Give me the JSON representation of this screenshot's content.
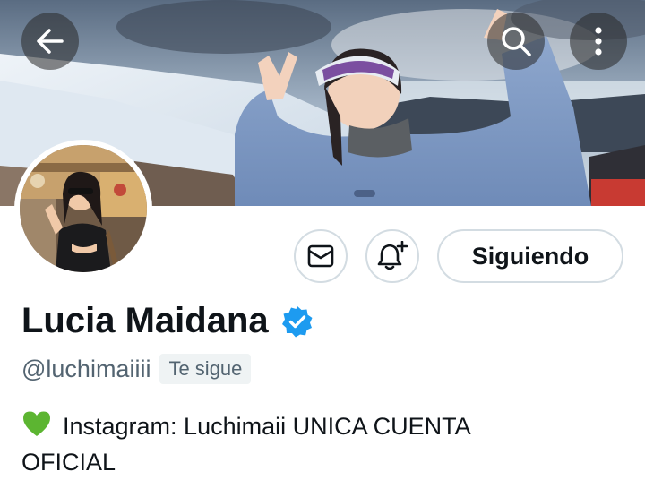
{
  "profile": {
    "name": "Lucia Maidana",
    "handle": "@luchimaiiii",
    "follows_you_badge": "Te sigue",
    "bio_line1": "Instagram: Luchimaii  UNICA CUENTA",
    "bio_line2": "OFICIAL",
    "verified": true
  },
  "actions": {
    "follow_label": "Siguiendo"
  },
  "icons": {
    "back": "arrow-left-icon",
    "search": "search-icon",
    "more": "more-vertical-icon",
    "message": "envelope-icon",
    "notify": "bell-plus-icon",
    "verified": "verified-badge-icon",
    "bio_emoji": "green-heart-emoji"
  },
  "colors": {
    "verified_blue": "#1d9bf0",
    "text_primary": "#0f1419",
    "text_secondary": "#536471",
    "button_border": "#d3dce2",
    "heart_green": "#5cb531"
  }
}
